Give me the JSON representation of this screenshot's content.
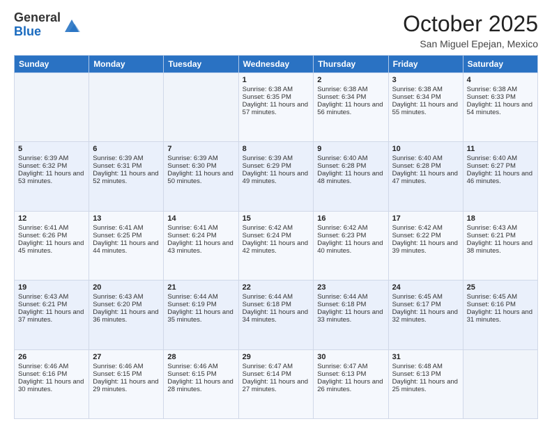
{
  "logo": {
    "general": "General",
    "blue": "Blue"
  },
  "header": {
    "month": "October 2025",
    "location": "San Miguel Epejan, Mexico"
  },
  "days_of_week": [
    "Sunday",
    "Monday",
    "Tuesday",
    "Wednesday",
    "Thursday",
    "Friday",
    "Saturday"
  ],
  "weeks": [
    [
      {
        "day": "",
        "info": ""
      },
      {
        "day": "",
        "info": ""
      },
      {
        "day": "",
        "info": ""
      },
      {
        "day": "1",
        "info": "Sunrise: 6:38 AM\nSunset: 6:35 PM\nDaylight: 11 hours and 57 minutes."
      },
      {
        "day": "2",
        "info": "Sunrise: 6:38 AM\nSunset: 6:34 PM\nDaylight: 11 hours and 56 minutes."
      },
      {
        "day": "3",
        "info": "Sunrise: 6:38 AM\nSunset: 6:34 PM\nDaylight: 11 hours and 55 minutes."
      },
      {
        "day": "4",
        "info": "Sunrise: 6:38 AM\nSunset: 6:33 PM\nDaylight: 11 hours and 54 minutes."
      }
    ],
    [
      {
        "day": "5",
        "info": "Sunrise: 6:39 AM\nSunset: 6:32 PM\nDaylight: 11 hours and 53 minutes."
      },
      {
        "day": "6",
        "info": "Sunrise: 6:39 AM\nSunset: 6:31 PM\nDaylight: 11 hours and 52 minutes."
      },
      {
        "day": "7",
        "info": "Sunrise: 6:39 AM\nSunset: 6:30 PM\nDaylight: 11 hours and 50 minutes."
      },
      {
        "day": "8",
        "info": "Sunrise: 6:39 AM\nSunset: 6:29 PM\nDaylight: 11 hours and 49 minutes."
      },
      {
        "day": "9",
        "info": "Sunrise: 6:40 AM\nSunset: 6:28 PM\nDaylight: 11 hours and 48 minutes."
      },
      {
        "day": "10",
        "info": "Sunrise: 6:40 AM\nSunset: 6:28 PM\nDaylight: 11 hours and 47 minutes."
      },
      {
        "day": "11",
        "info": "Sunrise: 6:40 AM\nSunset: 6:27 PM\nDaylight: 11 hours and 46 minutes."
      }
    ],
    [
      {
        "day": "12",
        "info": "Sunrise: 6:41 AM\nSunset: 6:26 PM\nDaylight: 11 hours and 45 minutes."
      },
      {
        "day": "13",
        "info": "Sunrise: 6:41 AM\nSunset: 6:25 PM\nDaylight: 11 hours and 44 minutes."
      },
      {
        "day": "14",
        "info": "Sunrise: 6:41 AM\nSunset: 6:24 PM\nDaylight: 11 hours and 43 minutes."
      },
      {
        "day": "15",
        "info": "Sunrise: 6:42 AM\nSunset: 6:24 PM\nDaylight: 11 hours and 42 minutes."
      },
      {
        "day": "16",
        "info": "Sunrise: 6:42 AM\nSunset: 6:23 PM\nDaylight: 11 hours and 40 minutes."
      },
      {
        "day": "17",
        "info": "Sunrise: 6:42 AM\nSunset: 6:22 PM\nDaylight: 11 hours and 39 minutes."
      },
      {
        "day": "18",
        "info": "Sunrise: 6:43 AM\nSunset: 6:21 PM\nDaylight: 11 hours and 38 minutes."
      }
    ],
    [
      {
        "day": "19",
        "info": "Sunrise: 6:43 AM\nSunset: 6:21 PM\nDaylight: 11 hours and 37 minutes."
      },
      {
        "day": "20",
        "info": "Sunrise: 6:43 AM\nSunset: 6:20 PM\nDaylight: 11 hours and 36 minutes."
      },
      {
        "day": "21",
        "info": "Sunrise: 6:44 AM\nSunset: 6:19 PM\nDaylight: 11 hours and 35 minutes."
      },
      {
        "day": "22",
        "info": "Sunrise: 6:44 AM\nSunset: 6:18 PM\nDaylight: 11 hours and 34 minutes."
      },
      {
        "day": "23",
        "info": "Sunrise: 6:44 AM\nSunset: 6:18 PM\nDaylight: 11 hours and 33 minutes."
      },
      {
        "day": "24",
        "info": "Sunrise: 6:45 AM\nSunset: 6:17 PM\nDaylight: 11 hours and 32 minutes."
      },
      {
        "day": "25",
        "info": "Sunrise: 6:45 AM\nSunset: 6:16 PM\nDaylight: 11 hours and 31 minutes."
      }
    ],
    [
      {
        "day": "26",
        "info": "Sunrise: 6:46 AM\nSunset: 6:16 PM\nDaylight: 11 hours and 30 minutes."
      },
      {
        "day": "27",
        "info": "Sunrise: 6:46 AM\nSunset: 6:15 PM\nDaylight: 11 hours and 29 minutes."
      },
      {
        "day": "28",
        "info": "Sunrise: 6:46 AM\nSunset: 6:15 PM\nDaylight: 11 hours and 28 minutes."
      },
      {
        "day": "29",
        "info": "Sunrise: 6:47 AM\nSunset: 6:14 PM\nDaylight: 11 hours and 27 minutes."
      },
      {
        "day": "30",
        "info": "Sunrise: 6:47 AM\nSunset: 6:13 PM\nDaylight: 11 hours and 26 minutes."
      },
      {
        "day": "31",
        "info": "Sunrise: 6:48 AM\nSunset: 6:13 PM\nDaylight: 11 hours and 25 minutes."
      },
      {
        "day": "",
        "info": ""
      }
    ]
  ]
}
